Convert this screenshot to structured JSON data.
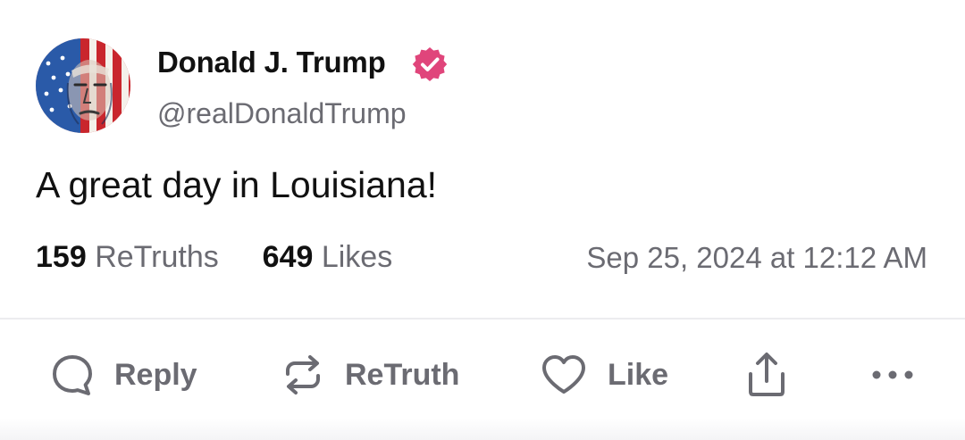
{
  "author": {
    "display_name": "Donald J. Trump",
    "handle": "@realDonaldTrump",
    "verified": true,
    "verified_color": "#e0457b",
    "avatar_icon": "flag-portrait-avatar"
  },
  "post": {
    "text": "A great day in Louisiana!",
    "retruths_count": "159",
    "retruths_label": "ReTruths",
    "likes_count": "649",
    "likes_label": "Likes",
    "timestamp": "Sep 25, 2024 at 12:12 AM"
  },
  "actions": {
    "reply_label": "Reply",
    "retruth_label": "ReTruth",
    "like_label": "Like",
    "share_icon": "share-icon",
    "more_icon": "more-icon"
  },
  "colors": {
    "text_primary": "#111111",
    "text_secondary": "#6b6b72",
    "icon_gray": "#6b6b72",
    "divider": "#ececef"
  }
}
